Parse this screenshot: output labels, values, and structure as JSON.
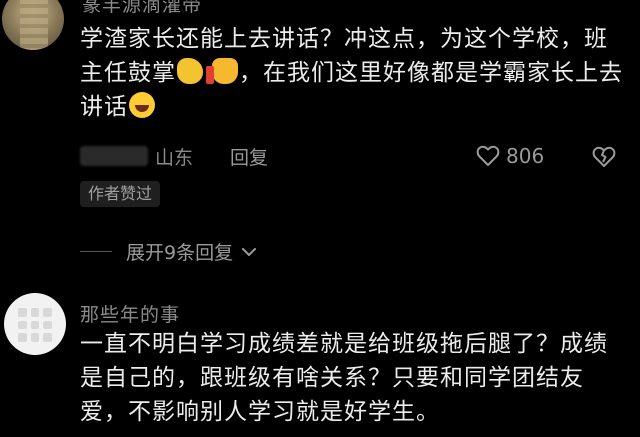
{
  "comments": [
    {
      "username": "篆丰源滴灌带",
      "text_parts": [
        "学渣家长还能上去讲话？冲这点，为这个学校，班主任鼓掌",
        "，在我们这里好像都是学霸家长上去讲话"
      ],
      "emoji_names": [
        "clapping-hands-emoji",
        "thumbs-up-emoji",
        "laughing-emoji"
      ],
      "location": "山东",
      "reply_label": "回复",
      "like_count": "806",
      "author_liked_label": "作者赞过",
      "expand_label": "展开9条回复"
    },
    {
      "username": "那些年的事",
      "text": "一直不明白学习成绩差就是给班级拖后腿了？成绩是自己的，跟班级有啥关系？只要和同学团结友爱，不影响别人学习就是好学生。"
    }
  ],
  "colors": {
    "background": "#000000",
    "text_primary": "#ececec",
    "text_secondary": "#8a8a8a",
    "badge_background": "#1f1f1f"
  },
  "icons": {
    "like": "heart-outline-icon",
    "dislike": "broken-heart-icon",
    "expand": "chevron-down-icon"
  }
}
